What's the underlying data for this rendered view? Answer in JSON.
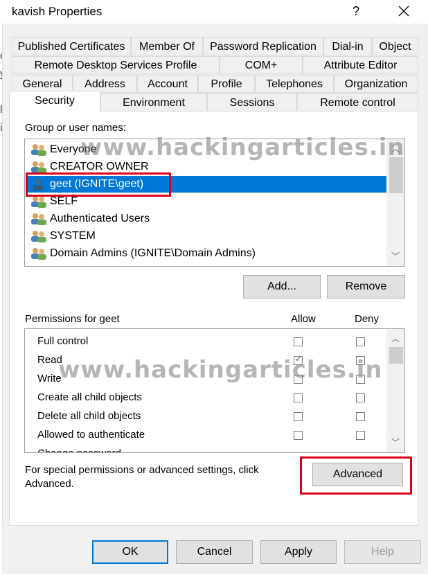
{
  "window": {
    "title": "kavish Properties",
    "help_glyph": "?",
    "close_glyph": "✕"
  },
  "backdrop": {
    "glyphs": [
      "c",
      "y",
      "l",
      "i"
    ]
  },
  "tabs": {
    "row1": [
      "Published Certificates",
      "Member Of",
      "Password Replication",
      "Dial-in",
      "Object"
    ],
    "row2": [
      "Remote Desktop Services Profile",
      "COM+",
      "Attribute Editor"
    ],
    "row3": [
      "General",
      "Address",
      "Account",
      "Profile",
      "Telephones",
      "Organization"
    ],
    "row4": [
      "Security",
      "Environment",
      "Sessions",
      "Remote control"
    ],
    "active": "Security"
  },
  "security": {
    "group_label": "Group or user names:",
    "users": [
      {
        "name": "Everyone",
        "icon": "group-icon"
      },
      {
        "name": "CREATOR OWNER",
        "icon": "group-icon"
      },
      {
        "name": "geet (IGNITE\\geet)",
        "icon": "user-icon",
        "selected": true
      },
      {
        "name": "SELF",
        "icon": "group-icon"
      },
      {
        "name": "Authenticated Users",
        "icon": "group-icon"
      },
      {
        "name": "SYSTEM",
        "icon": "group-icon"
      },
      {
        "name": "Domain Admins (IGNITE\\Domain Admins)",
        "icon": "group-icon"
      }
    ],
    "add_label": "Add...",
    "remove_label": "Remove",
    "perm_label": "Permissions for geet",
    "allow_label": "Allow",
    "deny_label": "Deny",
    "permissions": [
      {
        "name": "Full control",
        "allow": false,
        "deny": false
      },
      {
        "name": "Read",
        "allow": true,
        "deny": false
      },
      {
        "name": "Write",
        "allow": false,
        "deny": false
      },
      {
        "name": "Create all child objects",
        "allow": false,
        "deny": false
      },
      {
        "name": "Delete all child objects",
        "allow": false,
        "deny": false
      },
      {
        "name": "Allowed to authenticate",
        "allow": false,
        "deny": false
      },
      {
        "name": "Change password",
        "allow": false,
        "deny": false
      }
    ],
    "advanced_hint": "For special permissions or advanced settings, click Advanced.",
    "advanced_label": "Advanced"
  },
  "watermark": "www.hackingarticles.in",
  "footer": {
    "ok": "OK",
    "cancel": "Cancel",
    "apply": "Apply",
    "help": "Help"
  },
  "colors": {
    "selection": "#0078d7",
    "highlight_box": "#d9001b"
  }
}
